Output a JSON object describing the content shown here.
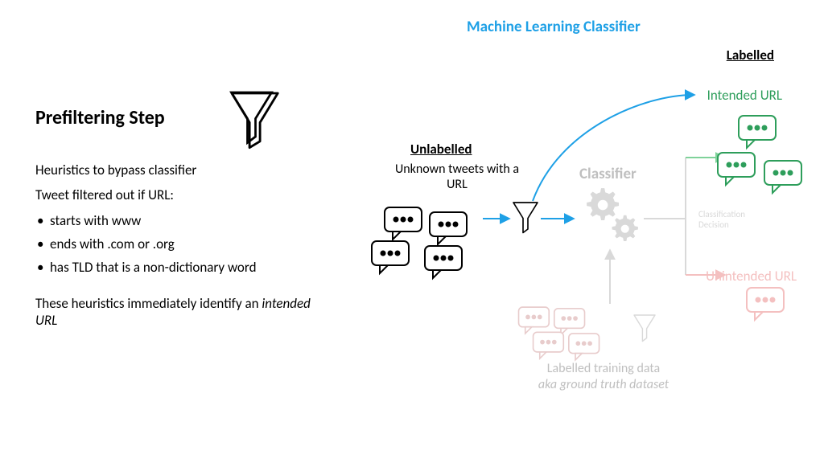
{
  "title": "Machine Learning Classifier",
  "labelled": "Labelled",
  "intended": "Intended URL",
  "unintended": "Unintended URL",
  "classifier": "Classifier",
  "classdec_line1": "Classification",
  "classdec_line2": "Decision",
  "unlabelled": "Unlabelled",
  "unknown_tweets": "Unknown tweets with a URL",
  "training_line1": "Labelled training data",
  "training_line2": "aka ground truth dataset",
  "left": {
    "heading": "Prefiltering Step",
    "intro1": "Heuristics to bypass classifier",
    "intro2": "Tweet filtered out if URL:",
    "bullets": [
      "starts with www",
      "ends with .com or .org",
      "has TLD that is a non-dictionary word"
    ],
    "closing_a": "These heuristics immediately identify an ",
    "closing_b": "intended URL"
  }
}
